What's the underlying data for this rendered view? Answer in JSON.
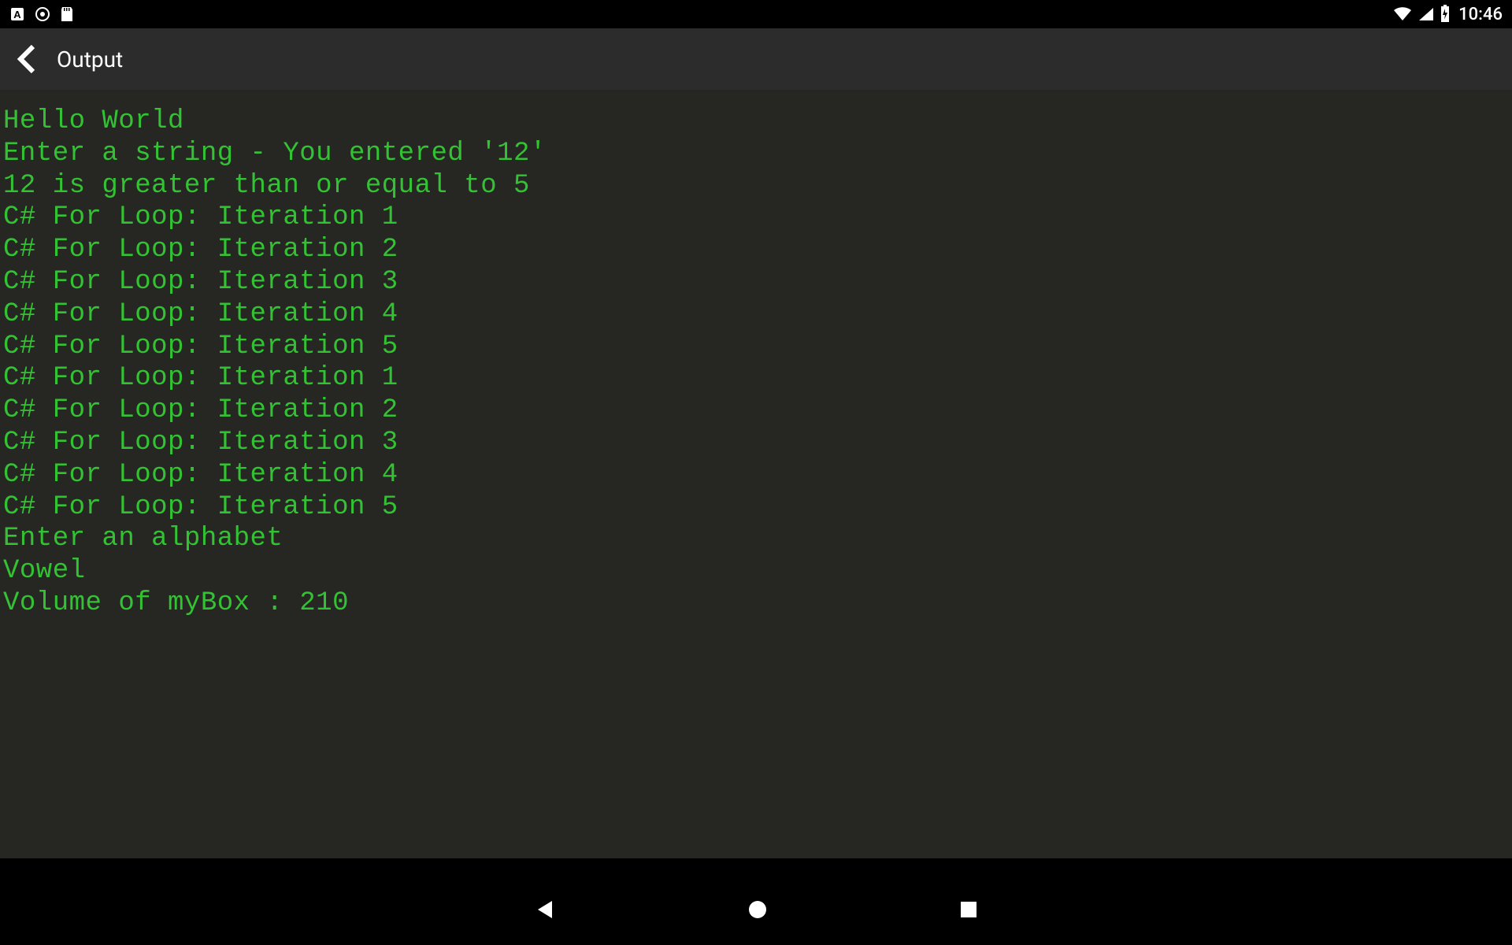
{
  "status_bar": {
    "time": "10:46"
  },
  "app_bar": {
    "title": "Output"
  },
  "console": {
    "lines": [
      "Hello World",
      "Enter a string - You entered '12'",
      "12 is greater than or equal to 5",
      "C# For Loop: Iteration 1",
      "C# For Loop: Iteration 2",
      "C# For Loop: Iteration 3",
      "C# For Loop: Iteration 4",
      "C# For Loop: Iteration 5",
      "C# For Loop: Iteration 1",
      "C# For Loop: Iteration 2",
      "C# For Loop: Iteration 3",
      "C# For Loop: Iteration 4",
      "C# For Loop: Iteration 5",
      "Enter an alphabet",
      "Vowel",
      "Volume of myBox : 210"
    ]
  }
}
